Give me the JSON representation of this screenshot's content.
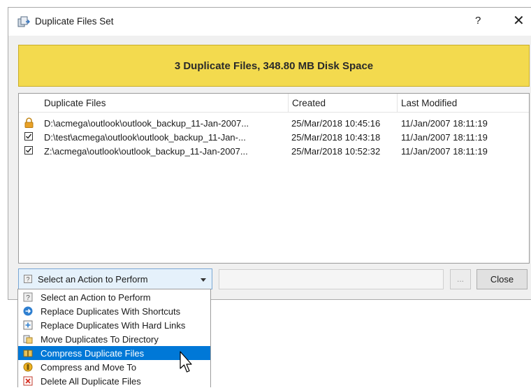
{
  "window": {
    "title": "Duplicate Files Set",
    "help": "?",
    "close_glyph": "✕"
  },
  "banner": {
    "text": "3 Duplicate Files, 348.80 MB Disk Space",
    "color": "#f3da4e"
  },
  "table": {
    "columns": [
      "Duplicate Files",
      "Created",
      "Last Modified"
    ],
    "rows": [
      {
        "state": "locked",
        "file": "D:\\acmega\\outlook\\outlook_backup_11-Jan-2007...",
        "created": "25/Mar/2018 10:45:16",
        "modified": "11/Jan/2007 18:11:19"
      },
      {
        "state": "checked",
        "file": "D:\\test\\acmega\\outlook\\outlook_backup_11-Jan-...",
        "created": "25/Mar/2018 10:43:18",
        "modified": "11/Jan/2007 18:11:19"
      },
      {
        "state": "checked",
        "file": "Z:\\acmega\\outlook\\outlook_backup_11-Jan-2007...",
        "created": "25/Mar/2018 10:52:32",
        "modified": "11/Jan/2007 18:11:19"
      }
    ]
  },
  "action_combo": {
    "selected": "Select an Action to Perform"
  },
  "buttons": {
    "browse": "...",
    "close": "Close"
  },
  "dropdown": {
    "items": [
      {
        "label": "Select an Action to Perform",
        "icon": "question-icon"
      },
      {
        "label": "Replace Duplicates With Shortcuts",
        "icon": "shortcut-arrow-icon"
      },
      {
        "label": "Replace Duplicates With Hard Links",
        "icon": "hard-link-icon"
      },
      {
        "label": "Move Duplicates To Directory",
        "icon": "move-folder-icon"
      },
      {
        "label": "Compress Duplicate Files",
        "icon": "compress-icon",
        "selected": true
      },
      {
        "label": "Compress and Move To",
        "icon": "compress-move-icon"
      },
      {
        "label": "Delete All Duplicate Files",
        "icon": "delete-icon"
      }
    ]
  },
  "colors": {
    "selection": "#0078d7",
    "combo_bg": "#e5f1fb"
  }
}
